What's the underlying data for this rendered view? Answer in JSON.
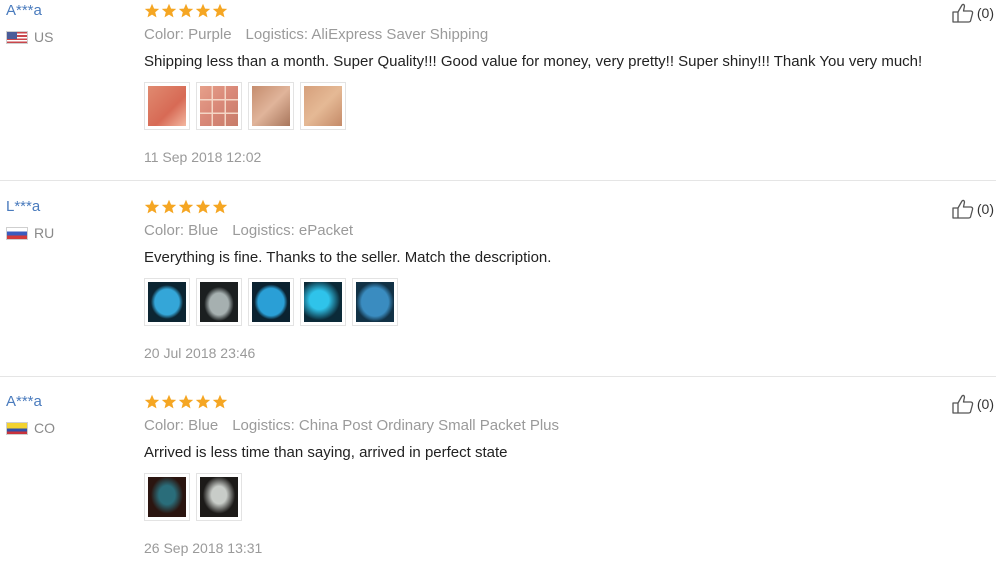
{
  "reviews": [
    {
      "user": "A***a",
      "country": "US",
      "rating": 5,
      "color_label": "Color: Purple",
      "logistics_label": "Logistics: AliExpress Saver Shipping",
      "comment": "Shipping less than a month. Super Quality!!! Good value for money, very pretty!! Super shiny!!! Thank You very much!",
      "photo_count": 4,
      "date": "11 Sep 2018 12:02",
      "helpful": "(0)"
    },
    {
      "user": "L***a",
      "country": "RU",
      "rating": 5,
      "color_label": "Color: Blue",
      "logistics_label": "Logistics: ePacket",
      "comment": "Everything is fine. Thanks to the seller. Match the description.",
      "photo_count": 5,
      "date": "20 Jul 2018 23:46",
      "helpful": "(0)"
    },
    {
      "user": "A***a",
      "country": "CO",
      "rating": 5,
      "color_label": "Color: Blue",
      "logistics_label": "Logistics: China Post Ordinary Small Packet Plus",
      "comment": "Arrived is less time than saying, arrived in perfect state",
      "photo_count": 2,
      "date": "26 Sep 2018 13:31",
      "helpful": "(0)"
    }
  ],
  "icons": {
    "star": "star-icon",
    "helpful": "thumbs-up-icon"
  },
  "colors": {
    "star": "#f5a623",
    "username": "#4a7bbd",
    "muted": "#9a9a9a"
  }
}
